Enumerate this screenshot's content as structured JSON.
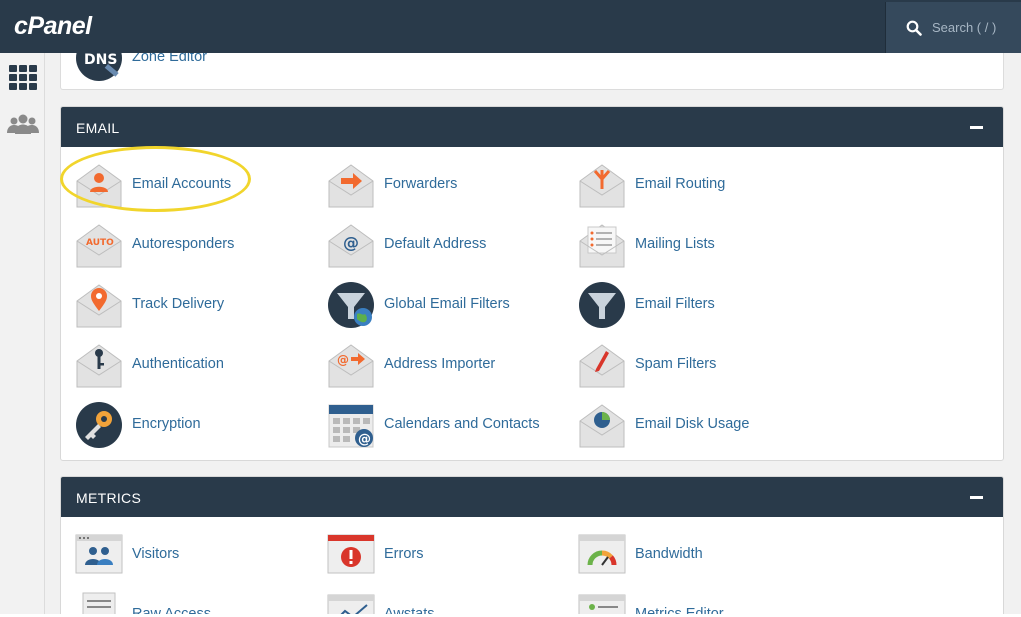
{
  "header": {
    "logo": "cPanel",
    "search_placeholder": "Search ( / )"
  },
  "prev_section": {
    "item_label": "Zone Editor",
    "icon_text": "DNS"
  },
  "email": {
    "title": "EMAIL",
    "items": [
      {
        "label": "Email Accounts"
      },
      {
        "label": "Forwarders"
      },
      {
        "label": "Email Routing"
      },
      {
        "label": "Autoresponders",
        "icon_text": "AUTO"
      },
      {
        "label": "Default Address"
      },
      {
        "label": "Mailing Lists"
      },
      {
        "label": "Track Delivery"
      },
      {
        "label": "Global Email Filters"
      },
      {
        "label": "Email Filters"
      },
      {
        "label": "Authentication"
      },
      {
        "label": "Address Importer"
      },
      {
        "label": "Spam Filters"
      },
      {
        "label": "Encryption"
      },
      {
        "label": "Calendars and Contacts"
      },
      {
        "label": "Email Disk Usage"
      }
    ]
  },
  "metrics": {
    "title": "METRICS",
    "items": [
      {
        "label": "Visitors"
      },
      {
        "label": "Errors"
      },
      {
        "label": "Bandwidth"
      },
      {
        "label": "Raw Access"
      },
      {
        "label": "Awstats"
      },
      {
        "label": "Metrics Editor"
      }
    ]
  },
  "colors": {
    "header_bg": "#293a4a",
    "link": "#2f6b9a",
    "accent_orange": "#f26a2f",
    "highlight": "#f1d52c"
  }
}
